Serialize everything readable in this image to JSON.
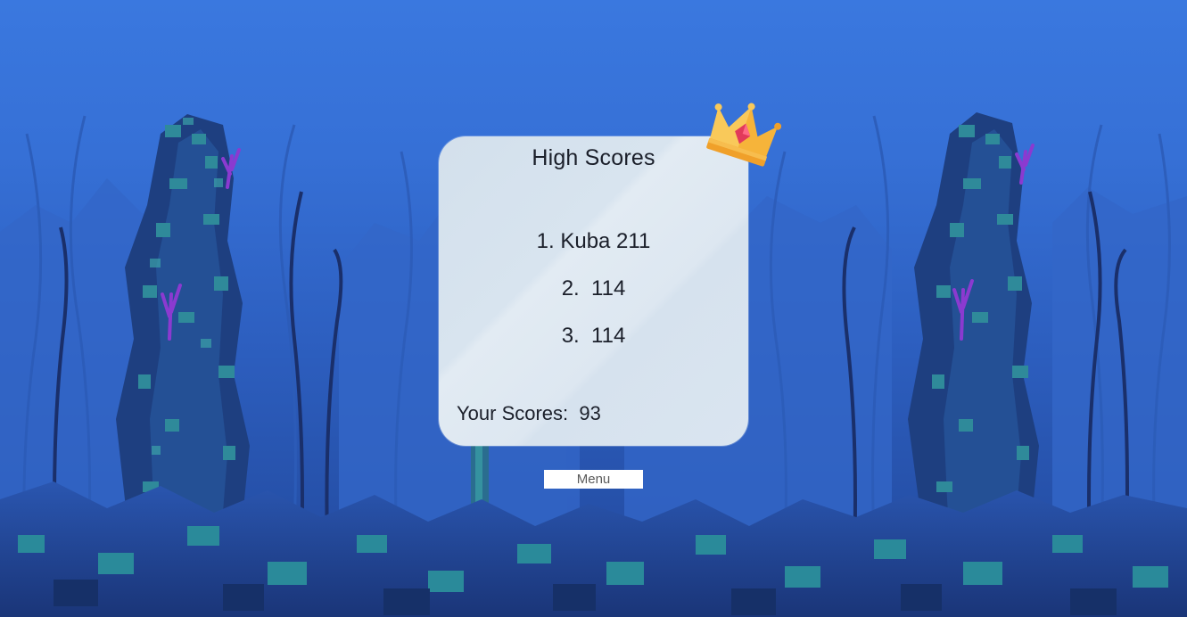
{
  "high_scores": {
    "title": "High Scores",
    "entries": [
      {
        "rank_label": "1. Kuba 211"
      },
      {
        "rank_label": "2.  114"
      },
      {
        "rank_label": "3.  114"
      }
    ],
    "your_scores_label": "Your Scores:  93"
  },
  "menu": {
    "button_label": "Menu"
  },
  "icons": {
    "crown": "crown-icon"
  },
  "colors": {
    "sky": "#3a78df",
    "panel": "#d8e4ef",
    "reef_dark": "#1c3a78",
    "reef_teal": "#2f8a9a",
    "coral": "#8b3ad0",
    "crown_gold": "#f6b43a",
    "crown_gem": "#e23a5a"
  }
}
